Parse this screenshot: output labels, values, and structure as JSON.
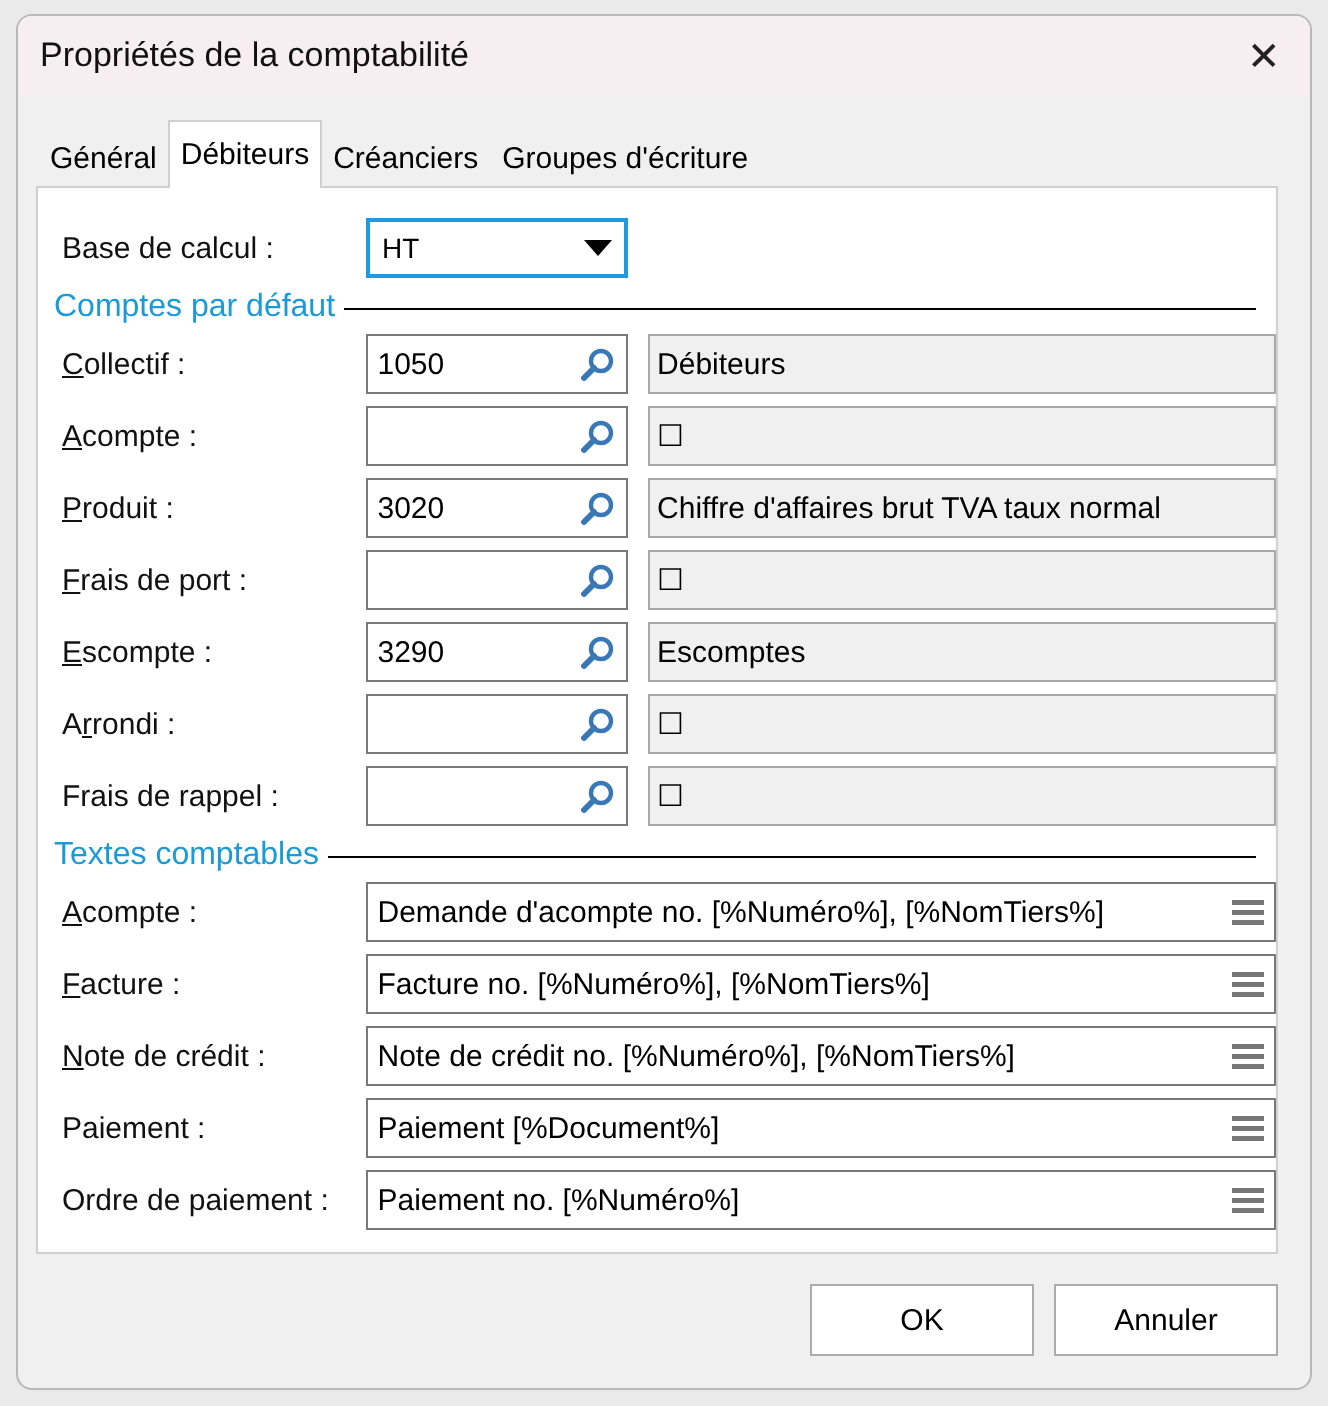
{
  "window": {
    "title": "Propriétés de la comptabilité",
    "close": "✕"
  },
  "tabs": [
    {
      "label": "Général",
      "selected": false
    },
    {
      "label": "Débiteurs",
      "selected": true
    },
    {
      "label": "Créanciers",
      "selected": false
    },
    {
      "label": "Groupes d'écriture",
      "selected": false
    }
  ],
  "base": {
    "label": [
      {
        "text": "Base de calcul :",
        "underlined": false
      }
    ],
    "value": "HT"
  },
  "accounts_section": "Comptes par défaut",
  "accounts": [
    {
      "label": [
        {
          "text": "C",
          "underlined": true
        },
        {
          "text": "ollectif :",
          "underlined": false
        }
      ],
      "number": "1050",
      "description": "Débiteurs"
    },
    {
      "label": [
        {
          "text": "A",
          "underlined": true
        },
        {
          "text": "compte :",
          "underlined": false
        }
      ],
      "description": "☐"
    },
    {
      "label": [
        {
          "text": "P",
          "underlined": true
        },
        {
          "text": "roduit :",
          "underlined": false
        }
      ],
      "number": "3020",
      "description": "Chiffre d'affaires brut TVA taux normal"
    },
    {
      "label": [
        {
          "text": "F",
          "underlined": true
        },
        {
          "text": "rais de port :",
          "underlined": false
        }
      ],
      "description": "☐"
    },
    {
      "label": [
        {
          "text": "E",
          "underlined": true
        },
        {
          "text": "scompte :",
          "underlined": false
        }
      ],
      "number": "3290",
      "description": "Escomptes"
    },
    {
      "label": [
        {
          "text": "A",
          "underlined": false
        },
        {
          "text": "r",
          "underlined": true
        },
        {
          "text": "rondi :",
          "underlined": false
        }
      ],
      "description": "☐"
    },
    {
      "label": [
        {
          "text": "Frais de rappel :",
          "underlined": false
        }
      ],
      "description": "☐"
    }
  ],
  "texts_section": "Textes comptables",
  "texts": [
    {
      "label": [
        {
          "text": "A",
          "underlined": true
        },
        {
          "text": "compte :",
          "underlined": false
        }
      ],
      "value": "Demande d'acompte no. [%Numéro%], [%NomTiers%]"
    },
    {
      "label": [
        {
          "text": "F",
          "underlined": true
        },
        {
          "text": "acture :",
          "underlined": false
        }
      ],
      "value": "Facture no. [%Numéro%], [%NomTiers%]"
    },
    {
      "label": [
        {
          "text": "N",
          "underlined": true
        },
        {
          "text": "ote de crédit :",
          "underlined": false
        }
      ],
      "value": "Note de crédit no. [%Numéro%], [%NomTiers%]"
    },
    {
      "label": [
        {
          "text": "Paiement :",
          "underlined": false
        }
      ],
      "value": "Paiement [%Document%]"
    },
    {
      "label": [
        {
          "text": "Ordre de paiement :",
          "underlined": false
        }
      ],
      "value": "Paiement no. [%Numéro%]"
    }
  ],
  "buttons": [
    "OK",
    "Annuler"
  ]
}
